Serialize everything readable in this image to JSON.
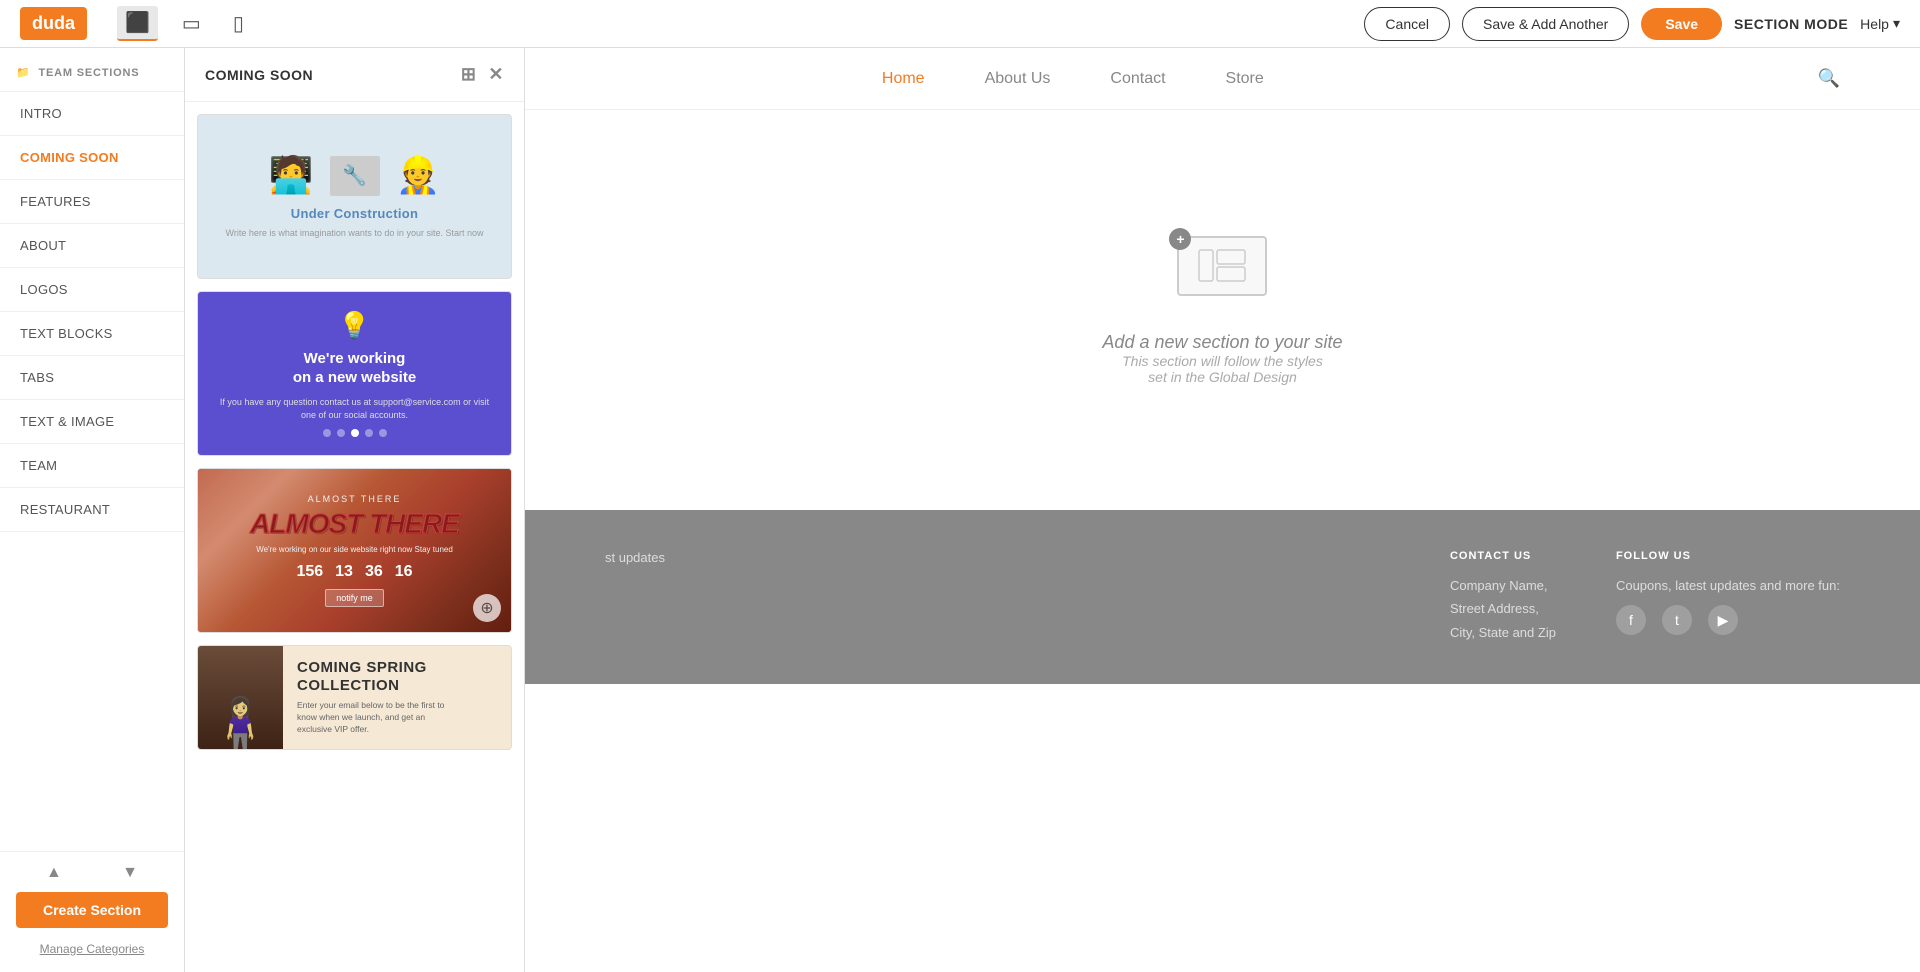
{
  "app": {
    "logo": "duda"
  },
  "topbar": {
    "cancel_label": "Cancel",
    "save_add_label": "Save & Add Another",
    "save_label": "Save",
    "section_mode_label": "SECTION MODE",
    "help_label": "Help"
  },
  "devices": [
    {
      "name": "desktop",
      "icon": "🖥",
      "active": true
    },
    {
      "name": "tablet",
      "icon": "⬜",
      "active": false
    },
    {
      "name": "mobile",
      "icon": "📱",
      "active": false
    }
  ],
  "sidebar": {
    "team_sections_label": "TEAM SECTIONS",
    "items": [
      {
        "label": "INTRO",
        "active": false
      },
      {
        "label": "COMING SOON",
        "active": true
      },
      {
        "label": "FEATURES",
        "active": false
      },
      {
        "label": "ABOUT",
        "active": false
      },
      {
        "label": "LOGOS",
        "active": false
      },
      {
        "label": "TEXT BLOCKS",
        "active": false
      },
      {
        "label": "TABS",
        "active": false
      },
      {
        "label": "TEXT & IMAGE",
        "active": false
      },
      {
        "label": "TEAM",
        "active": false
      },
      {
        "label": "RESTAURANT",
        "active": false
      }
    ],
    "create_section_label": "Create Section",
    "manage_categories_label": "Manage Categories"
  },
  "panel": {
    "title": "COMING SOON",
    "cards": [
      {
        "id": 1,
        "type": "under-construction",
        "title": "Under Construction",
        "subtitle": "Write here is what imagination wants to do in your site. Start now",
        "bg": "#dce8f0"
      },
      {
        "id": 2,
        "type": "working-new-website",
        "title": "We're working on a new website",
        "subtitle": "If you have any question contact us at support@service.com or visit one of our social accounts.",
        "emoji": "💡",
        "bg": "#5b4fcf",
        "dots": [
          false,
          false,
          true,
          false,
          false
        ]
      },
      {
        "id": 3,
        "type": "almost-there",
        "small_label": "ALMOST THERE",
        "title": "ALMOST THERE",
        "subtitle": "We're working on our side website right now Stay tuned",
        "nums": [
          {
            "val": "156",
            "label": ""
          },
          {
            "val": "13",
            "label": ""
          },
          {
            "val": "36",
            "label": ""
          },
          {
            "val": "16",
            "label": ""
          }
        ],
        "btn_label": "notify me"
      },
      {
        "id": 4,
        "type": "coming-spring-collection",
        "title": "COMING SPRING",
        "subtitle": "COLLECTION",
        "description": "Enter your email below to be the first to know when we launch, and get an exclusive VIP offer.",
        "bg": "#f5e8d5"
      }
    ]
  },
  "site": {
    "nav": [
      {
        "label": "Home",
        "active": true
      },
      {
        "label": "About Us",
        "active": false
      },
      {
        "label": "Contact",
        "active": false
      },
      {
        "label": "Store",
        "active": false
      }
    ],
    "add_section_title": "Add a new section to your site",
    "add_section_sub_1": "This section will follow the styles",
    "add_section_sub_2": "set in the Global Design"
  },
  "footer": {
    "col1": {
      "title": "CONTACT US",
      "lines": [
        "Company Name,",
        "Street Address,",
        "City, State and Zip"
      ]
    },
    "col2": {
      "title": "FOLLOW US",
      "text": "Coupons, latest updates and more fun:",
      "social": [
        "f",
        "t",
        "▶"
      ]
    }
  }
}
